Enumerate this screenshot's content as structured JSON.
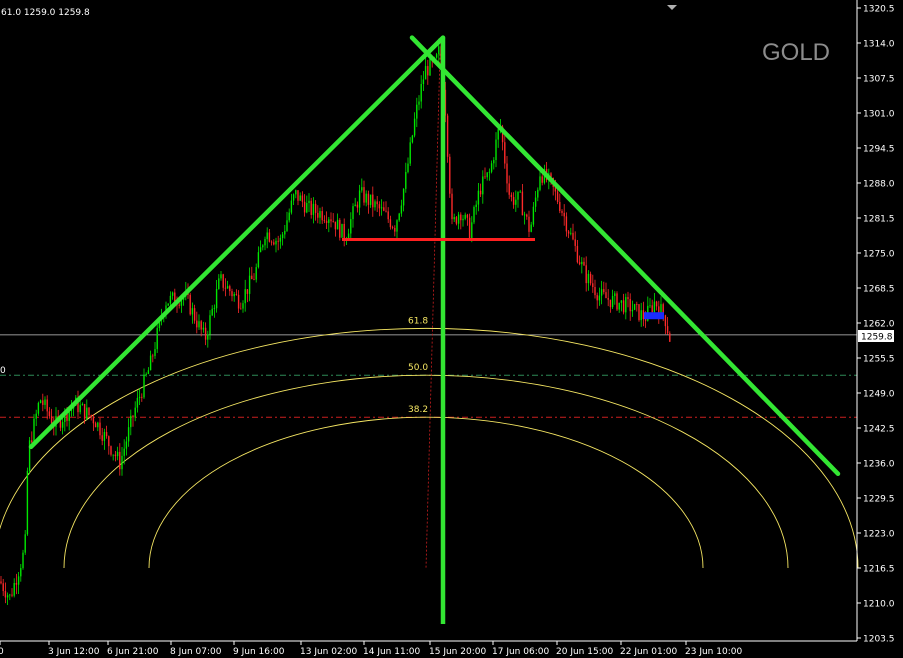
{
  "ohlc_readout": "61.0 1259.0 1259.8",
  "symbol": "GOLD",
  "left_level_stub": "0",
  "colors": {
    "background": "#000000",
    "bull_candle": "#00e600",
    "bear_candle": "#ff2a2a",
    "trendline": "#33e633",
    "neckline": "#ff2020",
    "fib_arc": "#f5e663",
    "fib_level_50": "#2e8b57",
    "fib_level_38": "#cc1f1f",
    "price_line": "#c8c8c8",
    "axis_text": "#ffffff"
  },
  "chart_data": {
    "type": "candlestick",
    "y_axis": {
      "range": [
        1200.0,
        1322.0
      ],
      "ticks": [
        "1320.5",
        "1314.0",
        "1307.5",
        "1301.0",
        "1294.5",
        "1288.0",
        "1281.5",
        "1275.0",
        "1268.5",
        "1262.0",
        "1255.5",
        "1249.0",
        "1242.5",
        "1236.0",
        "1229.5",
        "1223.0",
        "1216.5",
        "1210.0",
        "1203.5"
      ]
    },
    "x_axis": {
      "ticks": [
        "0",
        "3 Jun 12:00",
        "6 Jun 21:00",
        "8 Jun 07:00",
        "9 Jun 16:00",
        "13 Jun 02:00",
        "14 Jun 11:00",
        "15 Jun 20:00",
        "17 Jun 06:00",
        "20 Jun 15:00",
        "22 Jun 01:00",
        "23 Jun 10:00"
      ]
    },
    "current_price": "1259.8",
    "fib_levels": [
      {
        "label": "61.8",
        "price": 1261.0
      },
      {
        "label": "50.0",
        "price": 1252.3
      },
      {
        "label": "38.2",
        "price": 1244.5
      }
    ],
    "neckline_price": 1277.5,
    "trendlines": [
      {
        "from": [
          "3 Jun 12:00",
          1239.0
        ],
        "to": [
          "15 Jun 20:00",
          1315.0
        ]
      },
      {
        "from": [
          "15 Jun 20:00",
          1315.0
        ],
        "to": [
          "23 Jun 10:00",
          1234.0
        ]
      }
    ],
    "price_path": [
      [
        0,
        1214
      ],
      [
        10,
        1211
      ],
      [
        25,
        1220
      ],
      [
        28,
        1238
      ],
      [
        40,
        1248
      ],
      [
        55,
        1243
      ],
      [
        75,
        1247
      ],
      [
        95,
        1244
      ],
      [
        120,
        1236
      ],
      [
        135,
        1246
      ],
      [
        150,
        1254
      ],
      [
        165,
        1266
      ],
      [
        185,
        1267
      ],
      [
        205,
        1259
      ],
      [
        220,
        1270
      ],
      [
        240,
        1266
      ],
      [
        255,
        1271
      ],
      [
        265,
        1279
      ],
      [
        280,
        1277
      ],
      [
        295,
        1286
      ],
      [
        310,
        1283
      ],
      [
        330,
        1282
      ],
      [
        345,
        1278
      ],
      [
        360,
        1286
      ],
      [
        380,
        1283
      ],
      [
        395,
        1280
      ],
      [
        405,
        1288
      ],
      [
        415,
        1300
      ],
      [
        425,
        1309
      ],
      [
        435,
        1310
      ],
      [
        440,
        1313
      ],
      [
        445,
        1303
      ],
      [
        452,
        1280
      ],
      [
        460,
        1283
      ],
      [
        470,
        1279
      ],
      [
        480,
        1287
      ],
      [
        490,
        1290
      ],
      [
        500,
        1299
      ],
      [
        510,
        1285
      ],
      [
        520,
        1285
      ],
      [
        530,
        1279
      ],
      [
        540,
        1290
      ],
      [
        550,
        1288
      ],
      [
        560,
        1284
      ],
      [
        575,
        1276
      ],
      [
        585,
        1271
      ],
      [
        600,
        1267
      ],
      [
        615,
        1266
      ],
      [
        630,
        1265
      ],
      [
        645,
        1263
      ],
      [
        655,
        1266
      ],
      [
        665,
        1263
      ],
      [
        670,
        1259
      ]
    ]
  }
}
